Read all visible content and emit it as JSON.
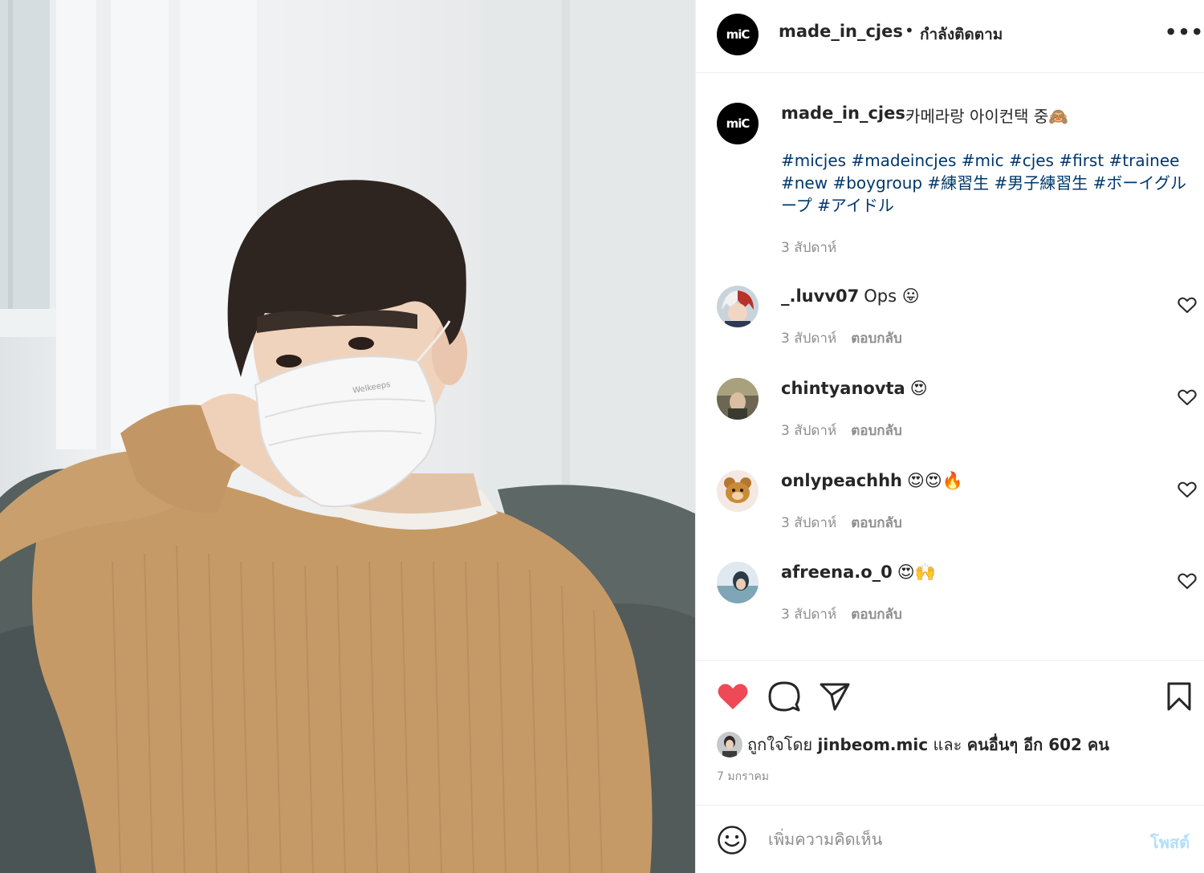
{
  "post": {
    "image_alt": "Young man with dark hair wearing a white face mask and tan knit sweater, resting his arm on a grey sofa",
    "mask_text": "Welkeeps"
  },
  "header": {
    "avatar_text": "miC",
    "username": "made_in_cjes",
    "separator": "•",
    "follow_status": "กำลังติดตาม",
    "more_icon": "•••"
  },
  "caption": {
    "avatar_text": "miC",
    "username": "made_in_cjes",
    "text": "카메라랑 아이컨택 중🙈",
    "hashtags": "#micjes #madeincjes #mic #cjes #first #trainee #new #boygroup #練習生 #男子練習生 #ボーイグループ #アイドル",
    "time": "3 สัปดาห์"
  },
  "comments": [
    {
      "username": "_.luvv07",
      "text": "Ops 😛",
      "time": "3 สัปดาห์",
      "reply": "ตอบกลับ"
    },
    {
      "username": "chintyanovta",
      "text": "😍",
      "time": "3 สัปดาห์",
      "reply": "ตอบกลับ"
    },
    {
      "username": "onlypeachhh",
      "text": "😍😍🔥",
      "time": "3 สัปดาห์",
      "reply": "ตอบกลับ"
    },
    {
      "username": "afreena.o_0",
      "text": "😍🙌",
      "time": "3 สัปดาห์",
      "reply": "ตอบกลับ"
    }
  ],
  "likes": {
    "prefix": "ถูกใจโดย",
    "liker": "jinbeom.mic",
    "conjunction": "และ",
    "others": "คนอื่นๆ อีก 602 คน"
  },
  "post_date": "7 มกราคม",
  "comment_input": {
    "placeholder": "เพิ่มความคิดเห็น",
    "post_label": "โพสต์"
  },
  "colors": {
    "liked_heart": "#ed4956",
    "hashtag": "#00376b",
    "secondary_text": "#8e8e8e",
    "post_button_disabled": "#b2dffc"
  }
}
